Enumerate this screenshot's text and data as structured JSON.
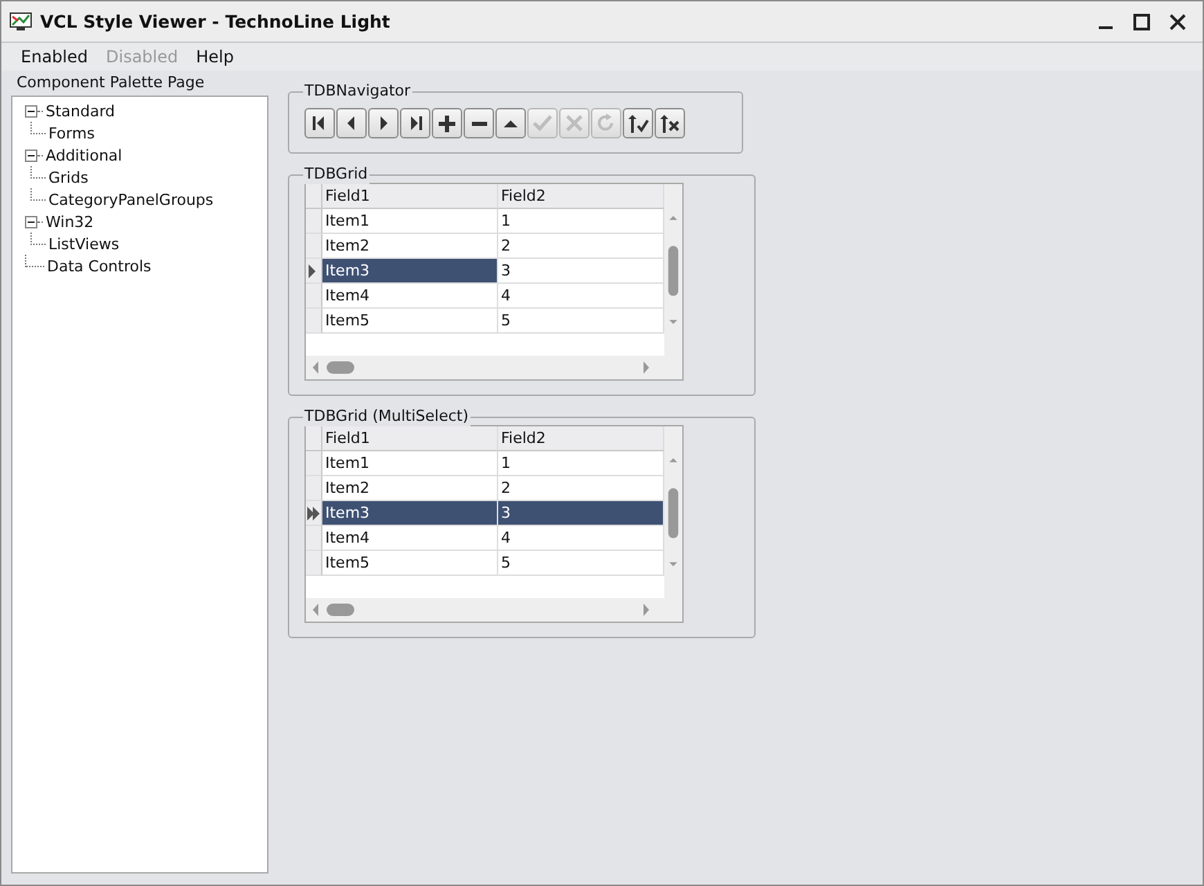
{
  "window": {
    "title": "VCL Style Viewer - TechnoLine Light"
  },
  "menu": [
    {
      "label": "Enabled",
      "disabled": false
    },
    {
      "label": "Disabled",
      "disabled": true
    },
    {
      "label": "Help",
      "disabled": false
    }
  ],
  "sidebar": {
    "label": "Component Palette Page",
    "tree": [
      {
        "label": "Standard",
        "expanded": true,
        "children": [
          {
            "label": "Forms"
          }
        ]
      },
      {
        "label": "Additional",
        "expanded": true,
        "children": [
          {
            "label": "Grids"
          },
          {
            "label": "CategoryPanelGroups"
          }
        ]
      },
      {
        "label": "Win32",
        "expanded": true,
        "children": [
          {
            "label": "ListViews"
          }
        ]
      },
      {
        "label": "Data Controls"
      }
    ]
  },
  "navigator": {
    "title": "TDBNavigator",
    "buttons": [
      {
        "kind": "first",
        "disabled": false
      },
      {
        "kind": "prior",
        "disabled": false
      },
      {
        "kind": "next",
        "disabled": false
      },
      {
        "kind": "last",
        "disabled": false
      },
      {
        "kind": "insert",
        "disabled": false
      },
      {
        "kind": "delete",
        "disabled": false
      },
      {
        "kind": "edit",
        "disabled": false
      },
      {
        "kind": "post",
        "disabled": true
      },
      {
        "kind": "cancel",
        "disabled": true
      },
      {
        "kind": "refresh",
        "disabled": true
      },
      {
        "kind": "apply",
        "disabled": false
      },
      {
        "kind": "cancel-updates",
        "disabled": false
      }
    ]
  },
  "grids": [
    {
      "title": "TDBGrid",
      "kind": "single",
      "columns": [
        "Field1",
        "Field2"
      ],
      "rows": [
        {
          "cells": [
            "Item1",
            "1"
          ],
          "selected": false
        },
        {
          "cells": [
            "Item2",
            "2"
          ],
          "selected": false
        },
        {
          "cells": [
            "Item3",
            "3"
          ],
          "selected": true
        },
        {
          "cells": [
            "Item4",
            "4"
          ],
          "selected": false
        },
        {
          "cells": [
            "Item5",
            "5"
          ],
          "selected": false
        }
      ]
    },
    {
      "title": "TDBGrid (MultiSelect)",
      "kind": "multi",
      "columns": [
        "Field1",
        "Field2"
      ],
      "rows": [
        {
          "cells": [
            "Item1",
            "1"
          ],
          "selected": false
        },
        {
          "cells": [
            "Item2",
            "2"
          ],
          "selected": false
        },
        {
          "cells": [
            "Item3",
            "3"
          ],
          "selected": true
        },
        {
          "cells": [
            "Item4",
            "4"
          ],
          "selected": false
        },
        {
          "cells": [
            "Item5",
            "5"
          ],
          "selected": false
        }
      ]
    }
  ]
}
